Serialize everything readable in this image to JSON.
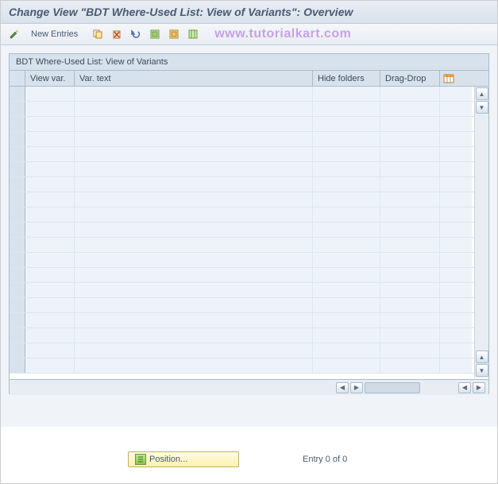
{
  "title": "Change View \"BDT Where-Used List: View of Variants\": Overview",
  "toolbar": {
    "new_entries_label": "New Entries"
  },
  "watermark": "www.tutorialkart.com",
  "panel": {
    "title": "BDT Where-Used List: View of Variants"
  },
  "table": {
    "columns": {
      "view_var": "View var.",
      "var_text": "Var. text",
      "hide_folders": "Hide folders",
      "drag_drop": "Drag-Drop"
    },
    "rows": [
      {
        "view_var": "",
        "var_text": "",
        "hide_folders": "",
        "drag_drop": ""
      },
      {
        "view_var": "",
        "var_text": "",
        "hide_folders": "",
        "drag_drop": ""
      },
      {
        "view_var": "",
        "var_text": "",
        "hide_folders": "",
        "drag_drop": ""
      },
      {
        "view_var": "",
        "var_text": "",
        "hide_folders": "",
        "drag_drop": ""
      },
      {
        "view_var": "",
        "var_text": "",
        "hide_folders": "",
        "drag_drop": ""
      },
      {
        "view_var": "",
        "var_text": "",
        "hide_folders": "",
        "drag_drop": ""
      },
      {
        "view_var": "",
        "var_text": "",
        "hide_folders": "",
        "drag_drop": ""
      },
      {
        "view_var": "",
        "var_text": "",
        "hide_folders": "",
        "drag_drop": ""
      },
      {
        "view_var": "",
        "var_text": "",
        "hide_folders": "",
        "drag_drop": ""
      },
      {
        "view_var": "",
        "var_text": "",
        "hide_folders": "",
        "drag_drop": ""
      },
      {
        "view_var": "",
        "var_text": "",
        "hide_folders": "",
        "drag_drop": ""
      },
      {
        "view_var": "",
        "var_text": "",
        "hide_folders": "",
        "drag_drop": ""
      },
      {
        "view_var": "",
        "var_text": "",
        "hide_folders": "",
        "drag_drop": ""
      },
      {
        "view_var": "",
        "var_text": "",
        "hide_folders": "",
        "drag_drop": ""
      },
      {
        "view_var": "",
        "var_text": "",
        "hide_folders": "",
        "drag_drop": ""
      },
      {
        "view_var": "",
        "var_text": "",
        "hide_folders": "",
        "drag_drop": ""
      },
      {
        "view_var": "",
        "var_text": "",
        "hide_folders": "",
        "drag_drop": ""
      },
      {
        "view_var": "",
        "var_text": "",
        "hide_folders": "",
        "drag_drop": ""
      },
      {
        "view_var": "",
        "var_text": "",
        "hide_folders": "",
        "drag_drop": ""
      }
    ]
  },
  "footer": {
    "position_label": "Position...",
    "entry_status": "Entry 0 of 0"
  }
}
